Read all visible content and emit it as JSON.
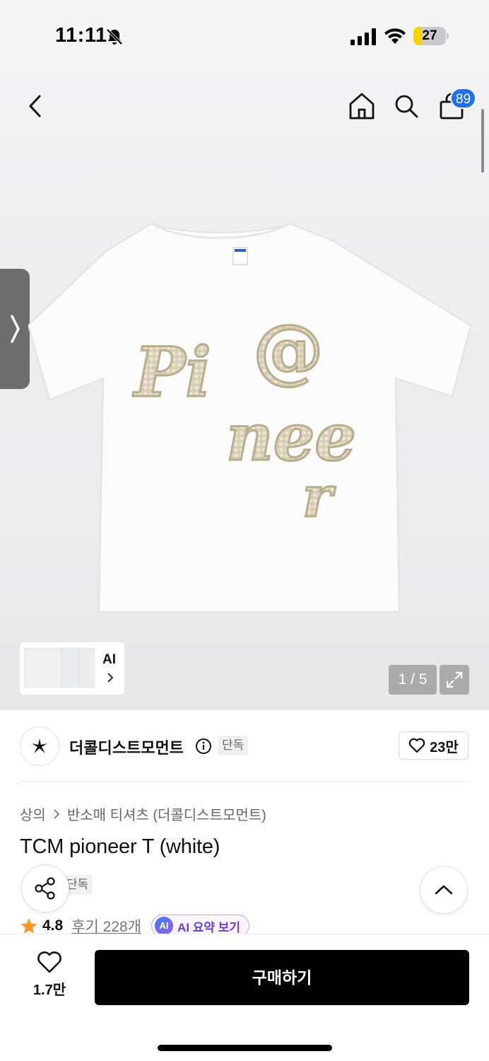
{
  "status_bar": {
    "time": "11:11",
    "battery_level": 27,
    "battery_label": "27",
    "icons": [
      "bell-slash-icon",
      "signal-icon",
      "wifi-icon",
      "battery-icon"
    ]
  },
  "top_nav": {
    "icons": [
      "back-icon",
      "home-icon",
      "search-icon",
      "cart-icon"
    ],
    "cart_count": "89"
  },
  "gallery": {
    "current_page": 1,
    "total_pages": 5,
    "page_label": "1 / 5",
    "ai_label": "AI",
    "shirt_text": "Pioneer"
  },
  "brand": {
    "name": "더콜디스트모먼트",
    "badge": "단독",
    "like_count": "23만"
  },
  "product": {
    "breadcrumb": [
      "상의",
      "반소매 티셔츠 (더콜디스트모먼트)"
    ],
    "title": "TCM pioneer T (white)",
    "badge": "단독",
    "rating": "4.8",
    "review_label": "후기 228개",
    "ai_icon_label": "AI",
    "ai_summary_label": "AI 요약 보기"
  },
  "bottom_bar": {
    "wish_count": "1.7만",
    "buy_label": "구매하기"
  },
  "colors": {
    "accent_blue": "#1f6ff0",
    "star": "#f59a23",
    "buy_button": "#000000",
    "battery_fill": "#f5d400",
    "ai_purple": "#6b3fd6"
  }
}
